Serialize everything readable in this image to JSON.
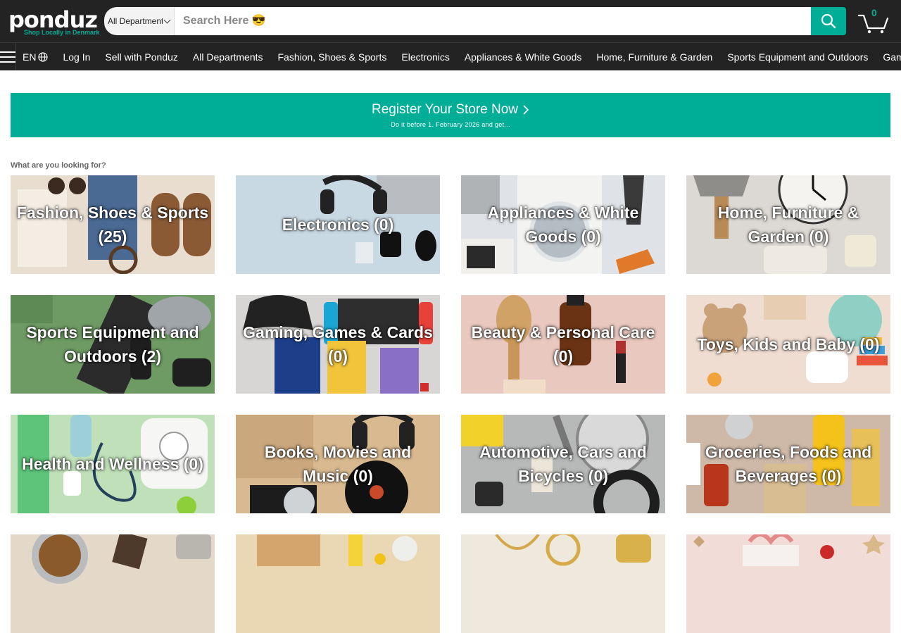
{
  "header": {
    "logo_text": "ponduz",
    "logo_tagline": "Shop Locally in Denmark",
    "department_select": "All Departments",
    "search_placeholder": "Search Here 😎",
    "cart_count": "0"
  },
  "nav": {
    "language": "EN",
    "links": [
      "Log In",
      "Sell with Ponduz",
      "All Departments",
      "Fashion, Shoes & Sports",
      "Electronics",
      "Appliances & White Goods",
      "Home, Furniture & Garden",
      "Sports Equipment and Outdoors",
      "Gaming, Games & Cards"
    ]
  },
  "banner": {
    "title": "Register Your Store Now",
    "subtitle": "Do it before 1. February 2026 and get..."
  },
  "section_label": "What are you looking for?",
  "categories": [
    {
      "label": "Fashion, Shoes & Sports (25)",
      "icon": "fashion-photo",
      "bg": "#e9ddd0"
    },
    {
      "label": "Electronics (0)",
      "icon": "electronics-photo",
      "bg": "#c9d9e4"
    },
    {
      "label": "Appliances & White Goods (0)",
      "icon": "appliances-photo",
      "bg": "#dfe2e6"
    },
    {
      "label": "Home, Furniture & Garden (0)",
      "icon": "home-photo",
      "bg": "#dcd8d3"
    },
    {
      "label": "Sports Equipment and Outdoors (2)",
      "icon": "sports-photo",
      "bg": "#6e9a63"
    },
    {
      "label": "Gaming, Games & Cards (0)",
      "icon": "gaming-photo",
      "bg": "#d8d6d4"
    },
    {
      "label": "Beauty & Personal Care (0)",
      "icon": "beauty-photo",
      "bg": "#e9c8bf"
    },
    {
      "label": "Toys, Kids and Baby (0)",
      "icon": "toys-photo",
      "bg": "#f0ddd2"
    },
    {
      "label": "Health and Wellness (0)",
      "icon": "health-photo",
      "bg": "#bfe0b8"
    },
    {
      "label": "Books, Movies and Music (0)",
      "icon": "books-photo",
      "bg": "#d9b98f"
    },
    {
      "label": "Automotive, Cars and Bicycles (0)",
      "icon": "automotive-photo",
      "bg": "#b7b8b8"
    },
    {
      "label": "Groceries, Foods and Beverages (0)",
      "icon": "groceries-photo",
      "bg": "#ceb9a8"
    },
    {
      "label": "",
      "icon": "pets-photo",
      "bg": "#e4d9c9"
    },
    {
      "label": "",
      "icon": "office-photo",
      "bg": "#ead8b4"
    },
    {
      "label": "",
      "icon": "jewelry-photo",
      "bg": "#efe8dc"
    },
    {
      "label": "",
      "icon": "gifts-photo",
      "bg": "#f2dcd7"
    }
  ],
  "colors": {
    "brand": "#00ae97",
    "header_bg": "#232323"
  }
}
